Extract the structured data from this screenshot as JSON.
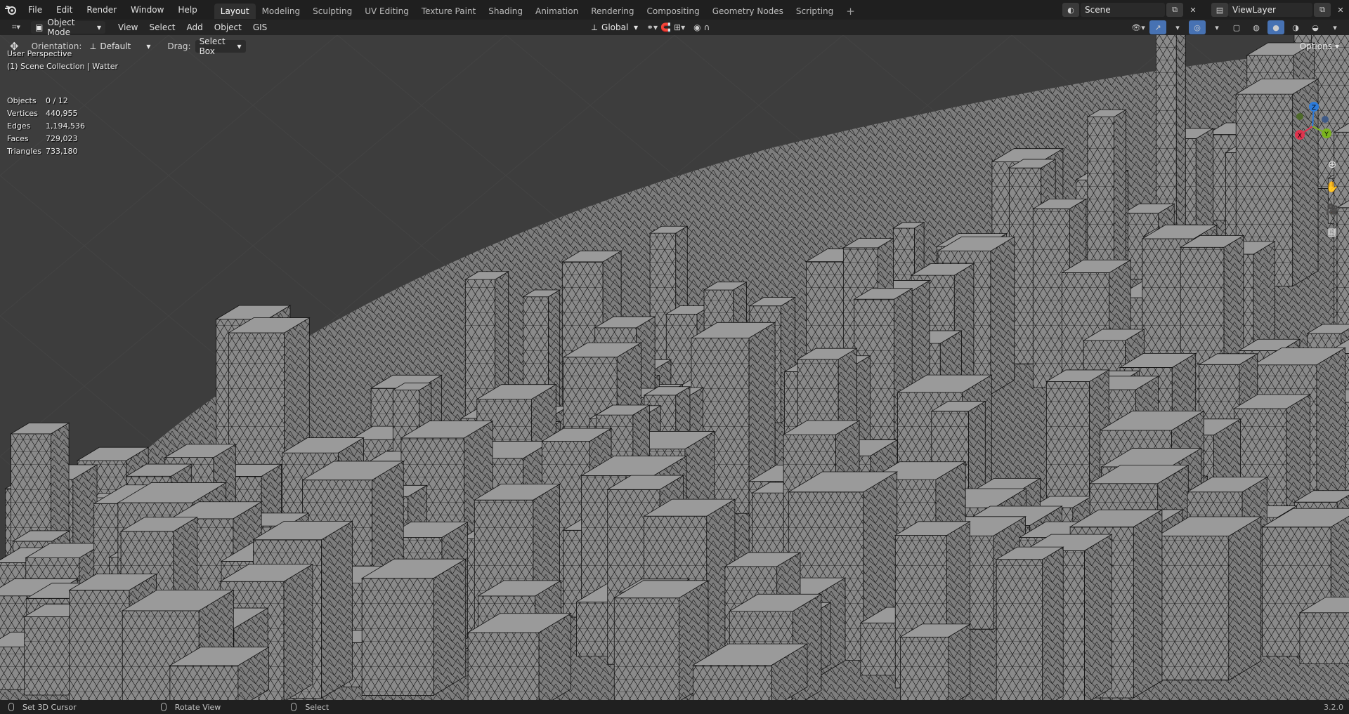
{
  "topbar": {
    "menus": [
      "File",
      "Edit",
      "Render",
      "Window",
      "Help"
    ],
    "workspaces": [
      "Layout",
      "Modeling",
      "Sculpting",
      "UV Editing",
      "Texture Paint",
      "Shading",
      "Animation",
      "Rendering",
      "Compositing",
      "Geometry Nodes",
      "Scripting"
    ],
    "active_workspace": "Layout",
    "scene": "Scene",
    "view_layer": "ViewLayer"
  },
  "header": {
    "mode": "Object Mode",
    "menus": [
      "View",
      "Select",
      "Add",
      "Object",
      "GIS"
    ],
    "transform_orientation": "Global",
    "options_label": "Options"
  },
  "tool_settings": {
    "orientation_label": "Orientation:",
    "orientation_value": "Default",
    "drag_label": "Drag:",
    "drag_value": "Select Box"
  },
  "viewport": {
    "view_name": "User Perspective",
    "collection": "(1) Scene Collection | Watter",
    "stats": [
      {
        "key": "Objects",
        "value": "0 / 12"
      },
      {
        "key": "Vertices",
        "value": "440,955"
      },
      {
        "key": "Edges",
        "value": "1,194,536"
      },
      {
        "key": "Faces",
        "value": "729,023"
      },
      {
        "key": "Triangles",
        "value": "733,180"
      }
    ],
    "gizmo_axes": [
      "X",
      "Y",
      "Z"
    ],
    "colors": {
      "x_axis": "#e0334d",
      "y_axis": "#7ab41e",
      "z_axis": "#2d7bda",
      "mesh": "#8c8c8c",
      "background": "#3d3d3d"
    }
  },
  "statusbar": {
    "items": [
      "Set 3D Cursor",
      "Rotate View",
      "Select"
    ],
    "version": "3.2.0"
  }
}
